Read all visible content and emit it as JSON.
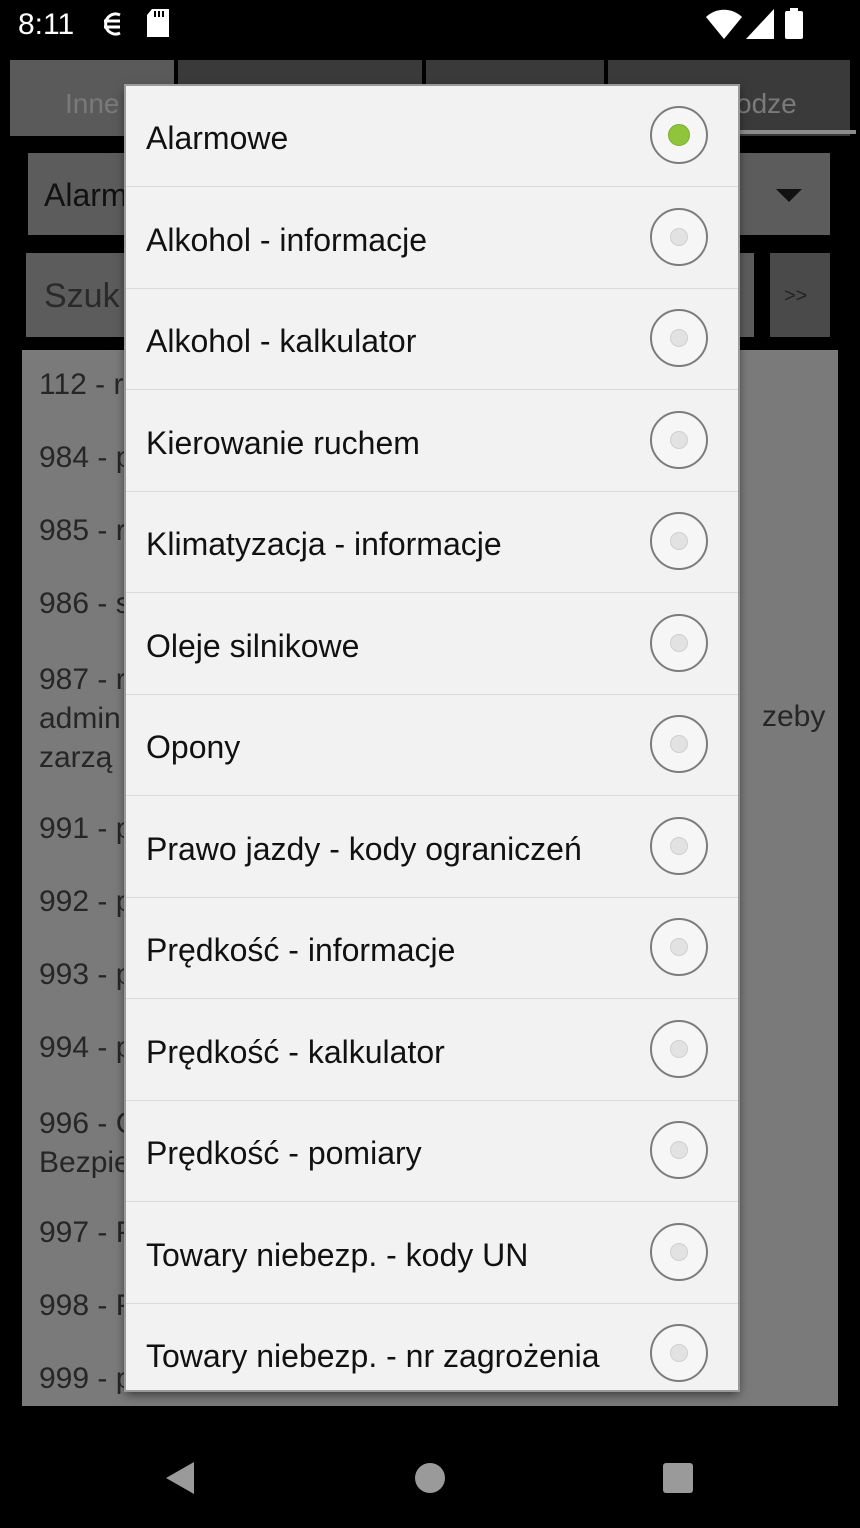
{
  "status_bar": {
    "time": "8:11",
    "icons": [
      "s-sync-icon",
      "sd-card-icon",
      "wifi-icon",
      "signal-icon",
      "battery-icon"
    ]
  },
  "tabs": [
    {
      "label": "Inne",
      "selected": true
    },
    {
      "label": "",
      "selected": false
    },
    {
      "label": "",
      "selected": false
    },
    {
      "label": "odze",
      "selected": false
    }
  ],
  "category_spinner": {
    "value": "Alarm"
  },
  "search": {
    "placeholder": "Szuk",
    "button_label": ">>"
  },
  "list": {
    "items": [
      {
        "line1": "112 - r"
      },
      {
        "line1": "984 - p"
      },
      {
        "line1": "985 - r"
      },
      {
        "line1": "986 - s"
      },
      {
        "line1": "987 - r",
        "line2": "admin",
        "line3": "zarzą"
      },
      {
        "line1": "991 - p"
      },
      {
        "line1": "992 - p"
      },
      {
        "line1": "993 - p"
      },
      {
        "line1": "994 - p"
      },
      {
        "line1": "996 - C",
        "line2": "Bezpie"
      },
      {
        "line1": "997 - P"
      },
      {
        "line1": "998 - P"
      },
      {
        "line1": "999 - p"
      }
    ],
    "tail_text": "zeby"
  },
  "dialog": {
    "options": [
      {
        "label": "Alarmowe",
        "checked": true
      },
      {
        "label": "Alkohol - informacje",
        "checked": false
      },
      {
        "label": "Alkohol - kalkulator",
        "checked": false
      },
      {
        "label": "Kierowanie ruchem",
        "checked": false
      },
      {
        "label": "Klimatyzacja - informacje",
        "checked": false
      },
      {
        "label": "Oleje silnikowe",
        "checked": false
      },
      {
        "label": "Opony",
        "checked": false
      },
      {
        "label": "Prawo jazdy - kody ograniczeń",
        "checked": false
      },
      {
        "label": "Prędkość - informacje",
        "checked": false
      },
      {
        "label": "Prędkość - kalkulator",
        "checked": false
      },
      {
        "label": "Prędkość - pomiary",
        "checked": false
      },
      {
        "label": "Towary niebezp. - kody UN",
        "checked": false
      },
      {
        "label": "Towary niebezp. - nr zagrożenia",
        "checked": false
      }
    ]
  },
  "colors": {
    "accent_radio": "#8fc43b",
    "dialog_bg": "#f2f2f2",
    "dim_list_bg": "#7a7a7a"
  }
}
